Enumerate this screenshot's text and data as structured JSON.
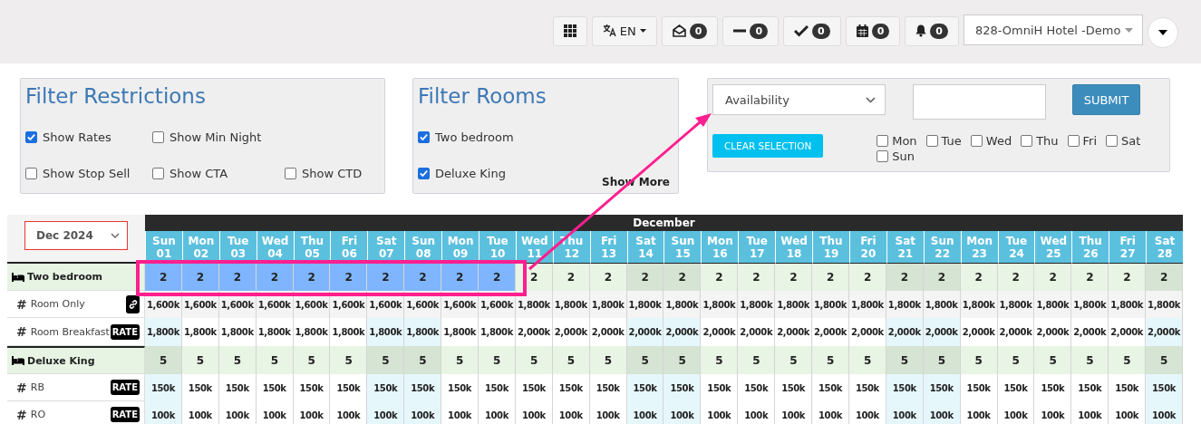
{
  "toolbar": {
    "buttons": [
      {
        "kind": "grid"
      },
      {
        "kind": "language",
        "label": "EN"
      },
      {
        "kind": "envelope",
        "count": "0"
      },
      {
        "kind": "minus",
        "count": "0"
      },
      {
        "kind": "check",
        "count": "0"
      },
      {
        "kind": "calendar",
        "count": "0"
      },
      {
        "kind": "bell",
        "count": "0"
      }
    ],
    "hotel_select": {
      "value": "828-OmniH Hotel -Demo"
    }
  },
  "filter_restrictions": {
    "title": "Filter Restrictions",
    "rows": [
      [
        {
          "label": "Show Rates",
          "checked": true
        },
        {
          "label": "Show Min Night",
          "checked": false
        }
      ],
      [
        {
          "label": "Show Stop Sell",
          "checked": false
        },
        {
          "label": "Show CTA",
          "checked": false
        },
        {
          "label": "Show CTD",
          "checked": false
        }
      ]
    ]
  },
  "filter_rooms": {
    "title": "Filter Rooms",
    "options": [
      {
        "label": "Two bedroom",
        "checked": true
      },
      {
        "label": "Deluxe King",
        "checked": true
      }
    ],
    "show_more": "Show More"
  },
  "bulk_update": {
    "field": {
      "value": "Availability"
    },
    "submit": "SUBMIT",
    "clear": "CLEAR SELECTION",
    "weekdays": [
      {
        "label": "Mon",
        "checked": false
      },
      {
        "label": "Tue",
        "checked": false
      },
      {
        "label": "Wed",
        "checked": false
      },
      {
        "label": "Thu",
        "checked": false
      },
      {
        "label": "Fri",
        "checked": false
      },
      {
        "label": "Sat",
        "checked": false
      },
      {
        "label": "Sun",
        "checked": false
      }
    ]
  },
  "calendar": {
    "month_select": "Dec 2024",
    "month": "December",
    "days": [
      {
        "name": "Sun",
        "date": "01",
        "weekend": true
      },
      {
        "name": "Mon",
        "date": "02",
        "weekend": false
      },
      {
        "name": "Tue",
        "date": "03",
        "weekend": false
      },
      {
        "name": "Wed",
        "date": "04",
        "weekend": false
      },
      {
        "name": "Thu",
        "date": "05",
        "weekend": false
      },
      {
        "name": "Fri",
        "date": "06",
        "weekend": false
      },
      {
        "name": "Sat",
        "date": "07",
        "weekend": true
      },
      {
        "name": "Sun",
        "date": "08",
        "weekend": true
      },
      {
        "name": "Mon",
        "date": "09",
        "weekend": false
      },
      {
        "name": "Tue",
        "date": "10",
        "weekend": false
      },
      {
        "name": "Wed",
        "date": "11",
        "weekend": false
      },
      {
        "name": "Thu",
        "date": "12",
        "weekend": false
      },
      {
        "name": "Fri",
        "date": "13",
        "weekend": false
      },
      {
        "name": "Sat",
        "date": "14",
        "weekend": true
      },
      {
        "name": "Sun",
        "date": "15",
        "weekend": true
      },
      {
        "name": "Mon",
        "date": "16",
        "weekend": false
      },
      {
        "name": "Tue",
        "date": "17",
        "weekend": false
      },
      {
        "name": "Wed",
        "date": "18",
        "weekend": false
      },
      {
        "name": "Thu",
        "date": "19",
        "weekend": false
      },
      {
        "name": "Fri",
        "date": "20",
        "weekend": false
      },
      {
        "name": "Sat",
        "date": "21",
        "weekend": true
      },
      {
        "name": "Sun",
        "date": "22",
        "weekend": true
      },
      {
        "name": "Mon",
        "date": "23",
        "weekend": false
      },
      {
        "name": "Tue",
        "date": "24",
        "weekend": false
      },
      {
        "name": "Wed",
        "date": "25",
        "weekend": false
      },
      {
        "name": "Thu",
        "date": "26",
        "weekend": false
      },
      {
        "name": "Fri",
        "date": "27",
        "weekend": false
      },
      {
        "name": "Sat",
        "date": "28",
        "weekend": true
      }
    ],
    "rows": [
      {
        "kind": "room",
        "name": "Two bedroom",
        "cells": [
          {
            "value": "2",
            "selected": true
          },
          {
            "value": "2",
            "selected": true
          },
          {
            "value": "2",
            "selected": true
          },
          {
            "value": "2",
            "selected": true
          },
          {
            "value": "2",
            "selected": true
          },
          {
            "value": "2",
            "selected": true
          },
          {
            "value": "2",
            "selected": true
          },
          {
            "value": "2",
            "selected": true
          },
          {
            "value": "2",
            "selected": true
          },
          {
            "value": "2",
            "selected": true
          },
          {
            "value": "2",
            "selected": false
          },
          {
            "value": "2",
            "selected": false
          },
          {
            "value": "2",
            "selected": false
          },
          {
            "value": "2",
            "selected": false
          },
          {
            "value": "2",
            "selected": false
          },
          {
            "value": "2",
            "selected": false
          },
          {
            "value": "2",
            "selected": false
          },
          {
            "value": "2",
            "selected": false
          },
          {
            "value": "2",
            "selected": false
          },
          {
            "value": "2",
            "selected": false
          },
          {
            "value": "2",
            "selected": false
          },
          {
            "value": "2",
            "selected": false
          },
          {
            "value": "2",
            "selected": false
          },
          {
            "value": "2",
            "selected": false
          },
          {
            "value": "2",
            "selected": false
          },
          {
            "value": "2",
            "selected": false
          },
          {
            "value": "2",
            "selected": false
          },
          {
            "value": "2",
            "selected": false
          }
        ]
      },
      {
        "kind": "linked-rate",
        "marker": "#",
        "name": "Room Only",
        "cells": [
          "1,600k",
          "1,600k",
          "1,600k",
          "1,600k",
          "1,600k",
          "1,600k",
          "1,600k",
          "1,600k",
          "1,600k",
          "1,600k",
          "1,800k",
          "1,800k",
          "1,800k",
          "1,800k",
          "1,800k",
          "1,800k",
          "1,800k",
          "1,800k",
          "1,800k",
          "1,800k",
          "1,800k",
          "1,800k",
          "1,800k",
          "1,800k",
          "1,800k",
          "1,800k",
          "1,800k",
          "1,800k"
        ]
      },
      {
        "kind": "rate",
        "marker": "#",
        "name": "Room Breakfast",
        "badge": "RATE",
        "cells": [
          "1,800k",
          "1,800k",
          "1,800k",
          "1,800k",
          "1,800k",
          "1,800k",
          "1,800k",
          "1,800k",
          "1,800k",
          "1,800k",
          "2,000k",
          "2,000k",
          "2,000k",
          "2,000k",
          "2,000k",
          "2,000k",
          "2,000k",
          "2,000k",
          "2,000k",
          "2,000k",
          "2,000k",
          "2,000k",
          "2,000k",
          "2,000k",
          "2,000k",
          "2,000k",
          "2,000k",
          "2,000k"
        ]
      },
      {
        "kind": "room",
        "name": "Deluxe King",
        "cells": [
          {
            "value": "5",
            "selected": false
          },
          {
            "value": "5",
            "selected": false
          },
          {
            "value": "5",
            "selected": false
          },
          {
            "value": "5",
            "selected": false
          },
          {
            "value": "5",
            "selected": false
          },
          {
            "value": "5",
            "selected": false
          },
          {
            "value": "5",
            "selected": false
          },
          {
            "value": "5",
            "selected": false
          },
          {
            "value": "5",
            "selected": false
          },
          {
            "value": "5",
            "selected": false
          },
          {
            "value": "5",
            "selected": false
          },
          {
            "value": "5",
            "selected": false
          },
          {
            "value": "5",
            "selected": false
          },
          {
            "value": "5",
            "selected": false
          },
          {
            "value": "5",
            "selected": false
          },
          {
            "value": "5",
            "selected": false
          },
          {
            "value": "5",
            "selected": false
          },
          {
            "value": "5",
            "selected": false
          },
          {
            "value": "5",
            "selected": false
          },
          {
            "value": "5",
            "selected": false
          },
          {
            "value": "5",
            "selected": false
          },
          {
            "value": "5",
            "selected": false
          },
          {
            "value": "5",
            "selected": false
          },
          {
            "value": "5",
            "selected": false
          },
          {
            "value": "5",
            "selected": false
          },
          {
            "value": "5",
            "selected": false
          },
          {
            "value": "5",
            "selected": false
          },
          {
            "value": "5",
            "selected": false
          }
        ]
      },
      {
        "kind": "rate",
        "marker": "#",
        "name": "RB",
        "badge": "RATE",
        "cells": [
          "150k",
          "150k",
          "150k",
          "150k",
          "150k",
          "150k",
          "150k",
          "150k",
          "150k",
          "150k",
          "150k",
          "150k",
          "150k",
          "150k",
          "150k",
          "150k",
          "150k",
          "150k",
          "150k",
          "150k",
          "150k",
          "150k",
          "150k",
          "150k",
          "150k",
          "150k",
          "150k",
          "150k"
        ]
      },
      {
        "kind": "rate",
        "marker": "#",
        "name": "RO",
        "badge": "RATE",
        "cells": [
          "100k",
          "100k",
          "100k",
          "100k",
          "100k",
          "100k",
          "100k",
          "100k",
          "100k",
          "100k",
          "100k",
          "100k",
          "100k",
          "100k",
          "100k",
          "100k",
          "100k",
          "100k",
          "100k",
          "100k",
          "100k",
          "100k",
          "100k",
          "100k",
          "100k",
          "100k",
          "100k",
          "100k"
        ]
      }
    ]
  }
}
